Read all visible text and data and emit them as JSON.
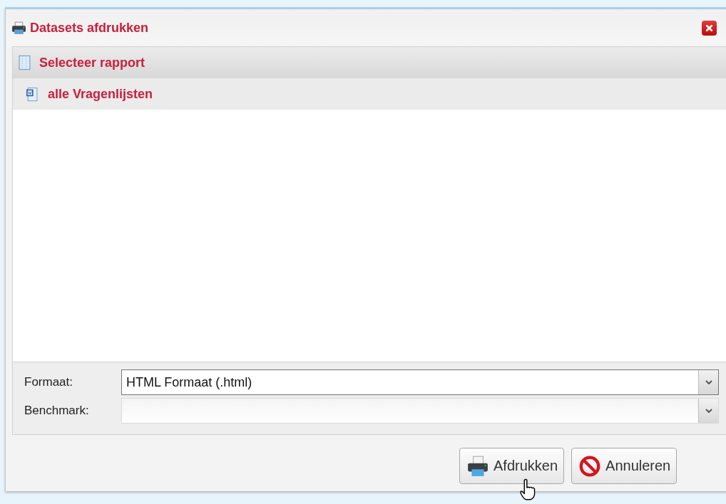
{
  "window": {
    "title": "Datasets afdrukken"
  },
  "report_panel": {
    "title": "Selecteer rapport",
    "items": [
      {
        "label": "alle Vragenlijsten",
        "selected": true
      }
    ]
  },
  "fields": [
    {
      "label": "Formaat:",
      "value": "HTML Formaat (.html)",
      "disabled": false
    },
    {
      "label": "Benchmark:",
      "disabled": true
    }
  ],
  "buttons": [
    {
      "kind": "print",
      "label": "Afdrukken"
    },
    {
      "kind": "cancel",
      "label": "Annuleren"
    }
  ]
}
